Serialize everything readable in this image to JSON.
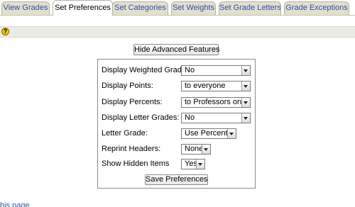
{
  "tabs": [
    {
      "label": "View Grades",
      "active": false
    },
    {
      "label": "Set Preferences",
      "active": true
    },
    {
      "label": "Set Categories",
      "active": false
    },
    {
      "label": "Set Weights",
      "active": false
    },
    {
      "label": "Set Grade Letters",
      "active": false
    },
    {
      "label": "Grade Exceptions",
      "active": false
    }
  ],
  "help": {
    "icon": "help-icon",
    "glyph": "?"
  },
  "advanced_button_label": "Hide Advanced Features",
  "preferences": {
    "rows": [
      {
        "label": "Display Weighted Grades:",
        "value": "No"
      },
      {
        "label": "Display Points:",
        "value": "to everyone"
      },
      {
        "label": "Display Percents:",
        "value": "to Professors only"
      },
      {
        "label": "Display Letter Grades:",
        "value": "No"
      },
      {
        "label": "Letter Grade:",
        "value": "Use Percent"
      },
      {
        "label": "Reprint Headers:",
        "value": "None"
      },
      {
        "label": "Show Hidden Items",
        "value": "Yes"
      }
    ],
    "save_label": "Save Preferences"
  },
  "footer_link_text": "his page",
  "colors": {
    "link": "#2a4fa8",
    "tab_bg": "#e3dfcf",
    "help_bar": "#ecebe3"
  }
}
